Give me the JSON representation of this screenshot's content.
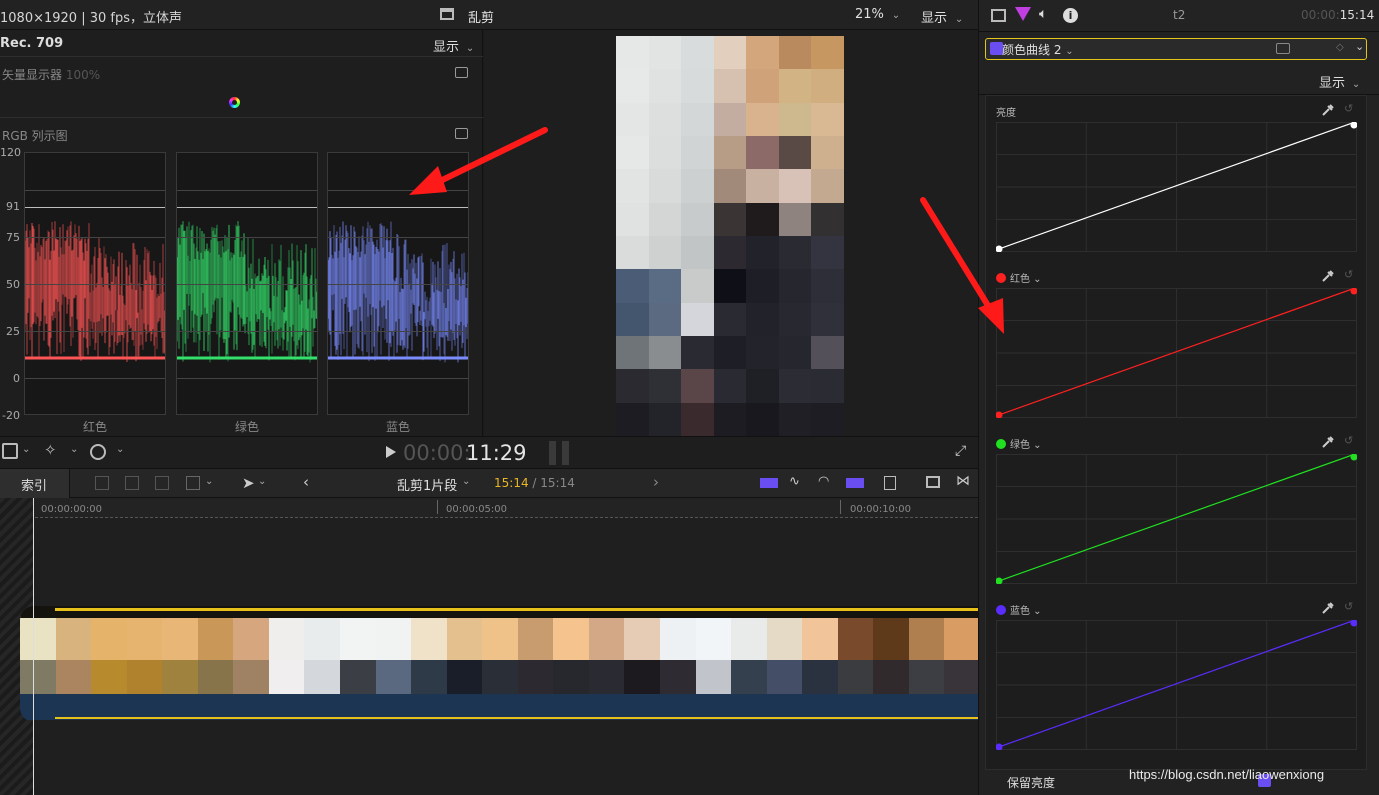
{
  "viewer": {
    "format": "1080×1920 | 30 fps，立体声",
    "project_title": "乱剪",
    "zoom": "21%",
    "view_label": "显示"
  },
  "scopes": {
    "colorspace": "Rec. 709",
    "view_label": "显示",
    "vectorscope_label": "矢量显示器",
    "vectorscope_pct": "100%",
    "rgb_parade_label": "RGB 列示图",
    "ticks": [
      "120",
      "91",
      "75",
      "50",
      "25",
      "0",
      "-20"
    ],
    "channels": [
      "红色",
      "绿色",
      "蓝色"
    ]
  },
  "transport": {
    "tc_dim": "00:00:",
    "tc_main": "11:29"
  },
  "timeline": {
    "index_label": "索引",
    "clip_title": "乱剪1片段",
    "clip_tc_current": "15:14",
    "clip_tc_total": " / 15:14",
    "ruler": [
      "00:00:00:00",
      "00:00:05:00",
      "00:00:10:00"
    ]
  },
  "inspector": {
    "name": "t2",
    "tc_dim": "00:00:",
    "tc_main": "15:14",
    "curve_name": "颜色曲线 2",
    "view_label": "显示",
    "curves": [
      {
        "label": "亮度",
        "color": "#ffffff"
      },
      {
        "label": "红色",
        "color": "#ff2020"
      },
      {
        "label": "绿色",
        "color": "#20e020"
      },
      {
        "label": "蓝色",
        "color": "#5a2cff"
      }
    ],
    "preserve_luma": "保留亮度"
  },
  "watermark": "https://blog.csdn.net/liaowenxiong",
  "colors": {
    "accent_yellow": "#e8c21a",
    "accent_purple": "#6b4ef2",
    "annotation_arrow": "#ff1a1a"
  }
}
